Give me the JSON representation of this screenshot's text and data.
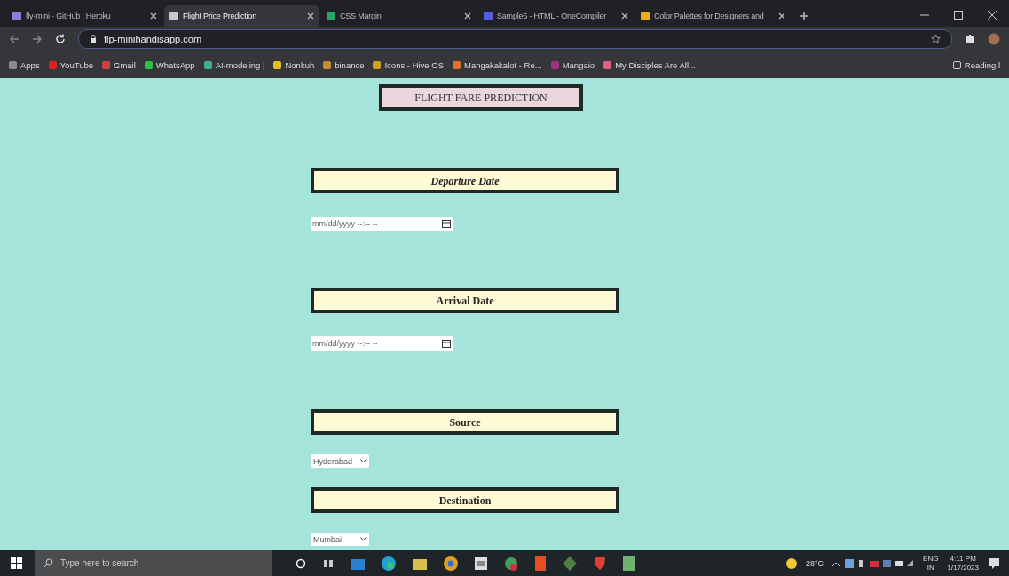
{
  "browser": {
    "tabs": [
      {
        "title": "fly-mini · GitHub | Heroku",
        "selected": false,
        "color": "#8a7fd8"
      },
      {
        "title": "Flight Price Prediction",
        "selected": true,
        "color": "#c8c8c8"
      },
      {
        "title": "CSS Margin",
        "selected": false,
        "color": "#2aa56a"
      },
      {
        "title": "Sample5 - HTML - OneCompiler",
        "selected": false,
        "color": "#5a5ae8"
      },
      {
        "title": "Color Palettes for Designers and",
        "selected": false,
        "color": "#e8b020"
      }
    ],
    "address": "flp-minihandisapp.com",
    "bookmarks": [
      {
        "label": "Apps",
        "color": "#8a8a8a"
      },
      {
        "label": "YouTube",
        "color": "#e02020"
      },
      {
        "label": "Gmail",
        "color": "#d04040"
      },
      {
        "label": "WhatsApp",
        "color": "#30c040"
      },
      {
        "label": "AI-modeling |",
        "color": "#40b090"
      },
      {
        "label": "Nonkuh",
        "color": "#e0c020"
      },
      {
        "label": "binance",
        "color": "#c09030"
      },
      {
        "label": "Icons - Hive OS",
        "color": "#d0a020"
      },
      {
        "label": "Mangakakalot - Re...",
        "color": "#e07030"
      },
      {
        "label": "Mangaio",
        "color": "#a03080"
      },
      {
        "label": "My Disciples Are All...",
        "color": "#e06080"
      }
    ],
    "reading_list": "Reading l"
  },
  "page": {
    "title": "FLIGHT FARE PREDICTION",
    "sections": [
      {
        "heading": "Departure Date",
        "italic": true,
        "kind": "datetime",
        "placeholder": "mm/dd/yyyy --:-- --"
      },
      {
        "heading": "Arrival Date",
        "italic": false,
        "kind": "datetime",
        "placeholder": "mm/dd/yyyy --:-- --"
      },
      {
        "heading": "Source",
        "italic": false,
        "kind": "select",
        "value": "Hyderabad"
      },
      {
        "heading": "Destination",
        "italic": false,
        "kind": "select",
        "value": "Mumbai"
      }
    ]
  },
  "taskbar": {
    "search_placeholder": "Type here to search",
    "weather": "28°C",
    "language": "ENG",
    "region": "IN",
    "time": "4:11 PM",
    "date": "1/17/2023"
  }
}
